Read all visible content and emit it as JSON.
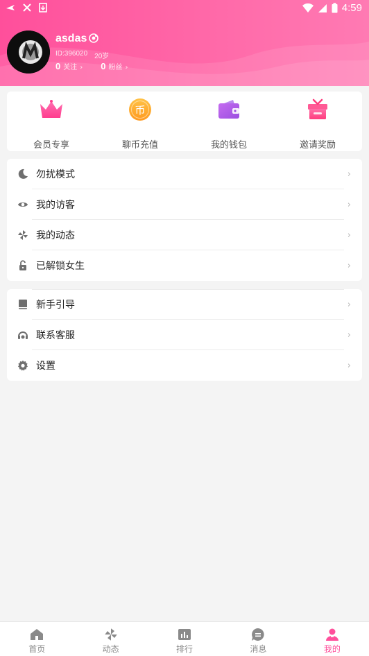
{
  "statusbar": {
    "time": "4:59"
  },
  "profile": {
    "username": "asdas",
    "id_text": "ID:396020",
    "age_text": "20岁",
    "following_count": "0",
    "following_label": "关注",
    "fans_count": "0",
    "fans_label": "粉丝"
  },
  "quick_actions": [
    {
      "label": "会员专享",
      "icon": "crown-icon"
    },
    {
      "label": "聊币充值",
      "icon": "coin-icon"
    },
    {
      "label": "我的钱包",
      "icon": "wallet-icon"
    },
    {
      "label": "邀请奖励",
      "icon": "gift-icon"
    }
  ],
  "menu_group1": [
    {
      "label": "勿扰模式",
      "icon": "moon-icon"
    },
    {
      "label": "我的访客",
      "icon": "eye-icon"
    },
    {
      "label": "我的动态",
      "icon": "pinwheel-icon"
    },
    {
      "label": "已解锁女生",
      "icon": "unlock-icon"
    }
  ],
  "menu_group2": [
    {
      "label": "新手引导",
      "icon": "book-icon"
    },
    {
      "label": "联系客服",
      "icon": "headset-icon"
    },
    {
      "label": "设置",
      "icon": "gear-icon"
    }
  ],
  "bottom_nav": [
    {
      "label": "首页",
      "icon": "home-icon"
    },
    {
      "label": "动态",
      "icon": "pinwheel-icon"
    },
    {
      "label": "排行",
      "icon": "ranking-icon"
    },
    {
      "label": "消息",
      "icon": "message-icon"
    },
    {
      "label": "我的",
      "icon": "profile-icon",
      "active": true
    }
  ],
  "colors": {
    "accent": "#ff4f9b",
    "header_gradient_end": "#ff7ab3"
  }
}
